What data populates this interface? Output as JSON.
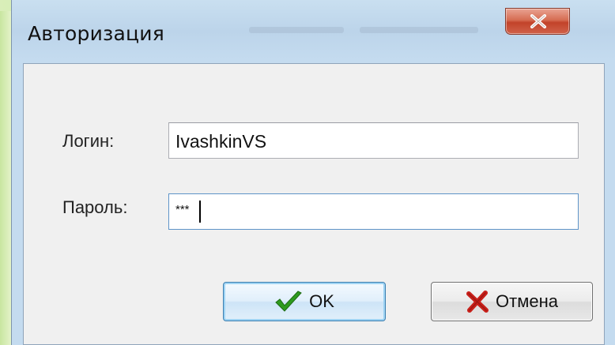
{
  "window": {
    "title": "Авторизация"
  },
  "form": {
    "login_label": "Логин:",
    "login_value": "IvashkinVS",
    "password_label": "Пароль:",
    "password_value": "***"
  },
  "buttons": {
    "ok_label": "OK",
    "cancel_label": "Отмена"
  },
  "icons": {
    "close": "close-icon",
    "ok": "checkmark-icon",
    "cancel": "cross-icon"
  },
  "colors": {
    "close_button": "#c2432a",
    "ok_check": "#2e9a1e",
    "cancel_cross": "#c8201a",
    "focus_border": "#3c7fb1"
  }
}
